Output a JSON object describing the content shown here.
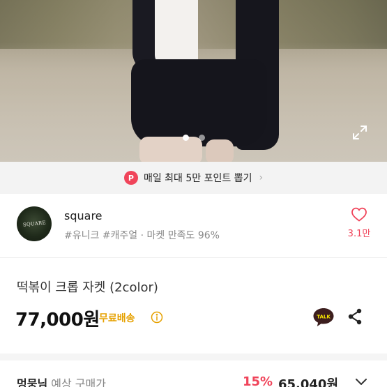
{
  "carousel": {
    "total": 2,
    "active": 1
  },
  "banner": {
    "badge": "P",
    "text": "매일 최대 5만 포인트 뽑기",
    "chevron": "›"
  },
  "seller": {
    "avatar_text": "SQUARE",
    "name": "square",
    "tags": "#유니크 #캐주얼 · 마켓 만족도 96%",
    "like_count": "3.1만"
  },
  "product": {
    "title": "떡볶이 크롭 자켓 (2color)",
    "price": "77,000원",
    "shipping": "무료배송"
  },
  "purchase": {
    "member_name": "멍뭉님",
    "member_label": "예상 구매가",
    "discount": "15%",
    "price": "65,040원"
  },
  "colors": {
    "accent": "#f0445a",
    "shipping": "#e6a100",
    "kakao": "#3c1e1e"
  },
  "icons": [
    "expand-icon",
    "heart-icon",
    "info-icon",
    "kakao-talk-icon",
    "share-icon",
    "chevron-down-icon"
  ]
}
